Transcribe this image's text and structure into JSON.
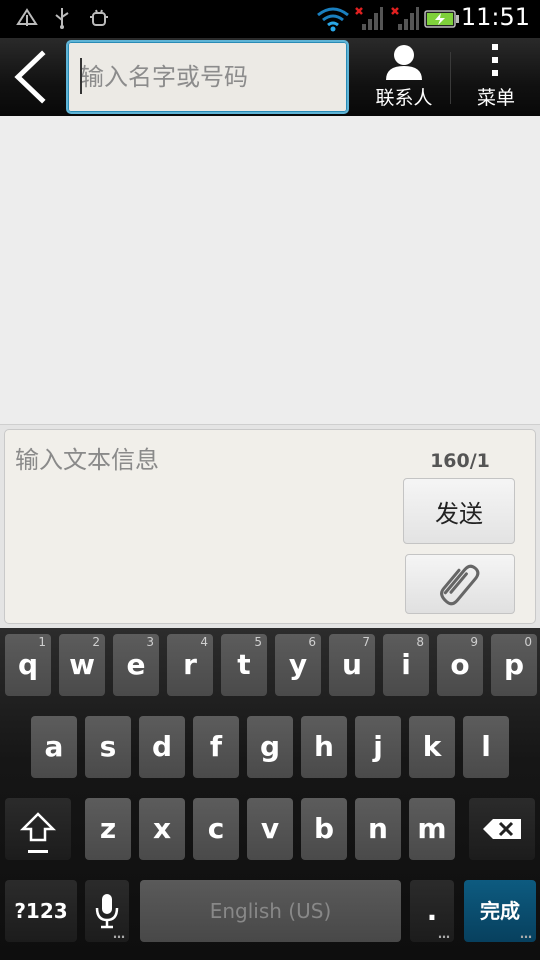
{
  "status_bar": {
    "time": "11:51",
    "icons": [
      "notification-up-icon",
      "usb-icon",
      "android-debug-icon",
      "wifi-icon",
      "signal-no-service-icon",
      "signal-no-service-icon",
      "battery-charging-icon"
    ]
  },
  "action_bar": {
    "recipient_placeholder": "输入名字或号码",
    "contacts_label": "联系人",
    "menu_label": "菜单"
  },
  "compose": {
    "placeholder": "输入文本信息",
    "counter": "160/1",
    "send_label": "发送"
  },
  "keyboard": {
    "row1": [
      {
        "k": "q",
        "n": "1"
      },
      {
        "k": "w",
        "n": "2"
      },
      {
        "k": "e",
        "n": "3"
      },
      {
        "k": "r",
        "n": "4"
      },
      {
        "k": "t",
        "n": "5"
      },
      {
        "k": "y",
        "n": "6"
      },
      {
        "k": "u",
        "n": "7"
      },
      {
        "k": "i",
        "n": "8"
      },
      {
        "k": "o",
        "n": "9"
      },
      {
        "k": "p",
        "n": "0"
      }
    ],
    "row2": [
      "a",
      "s",
      "d",
      "f",
      "g",
      "h",
      "j",
      "k",
      "l"
    ],
    "row3": [
      "z",
      "x",
      "c",
      "v",
      "b",
      "n",
      "m"
    ],
    "symbols_label": "?123",
    "space_label": "English (US)",
    "period_label": ".",
    "done_label": "完成"
  },
  "colors": {
    "accent": "#5fb4d6",
    "done_key": "#0d5b80",
    "battery": "#7fd13b"
  }
}
